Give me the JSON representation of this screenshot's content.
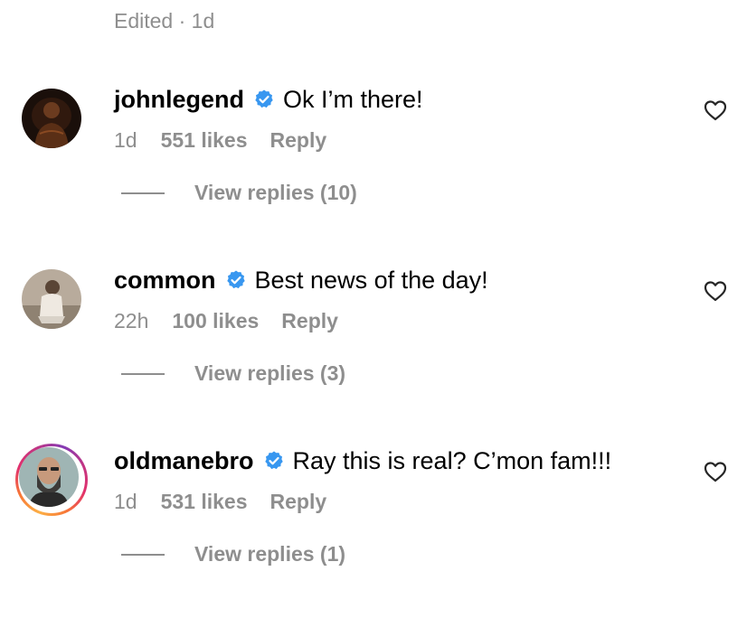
{
  "edited_label": "Edited · 1d",
  "colors": {
    "verified": "#3897f0",
    "muted": "#8e8e8e",
    "text": "#000000"
  },
  "comments": [
    {
      "username": "johnlegend",
      "verified_icon": "verified-badge-icon",
      "text": "Ok I’m there!",
      "time": "1d",
      "likes": "551 likes",
      "reply_label": "Reply",
      "view_replies": "View replies (10)"
    },
    {
      "username": "common",
      "verified_icon": "verified-badge-icon",
      "text": "Best news of the day!",
      "time": "22h",
      "likes": "100 likes",
      "reply_label": "Reply",
      "view_replies": "View replies (3)"
    },
    {
      "username": "oldmanebro",
      "verified_icon": "verified-badge-icon",
      "text": "Ray this is real? C’mon fam!!!",
      "time": "1d",
      "likes": "531 likes",
      "reply_label": "Reply",
      "view_replies": "View replies (1)"
    }
  ]
}
